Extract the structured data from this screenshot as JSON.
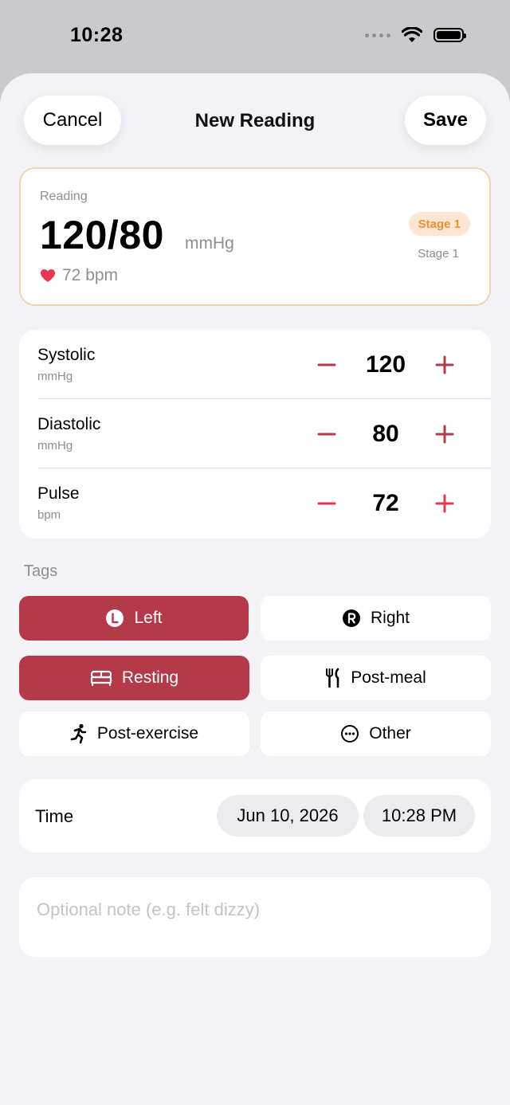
{
  "status_bar": {
    "time": "10:28"
  },
  "nav": {
    "cancel_label": "Cancel",
    "title": "New Reading",
    "save_label": "Save"
  },
  "summary": {
    "label": "Reading",
    "value": "120/80",
    "unit": "mmHg",
    "pulse": "72 bpm",
    "stage_badge": "Stage 1",
    "stage_text": "Stage 1"
  },
  "steppers": [
    {
      "name": "Systolic",
      "unit": "mmHg",
      "value": "120"
    },
    {
      "name": "Diastolic",
      "unit": "mmHg",
      "value": "80"
    },
    {
      "name": "Pulse",
      "unit": "bpm",
      "value": "72"
    }
  ],
  "tags": {
    "section_label": "Tags",
    "items": [
      {
        "label": "Left",
        "icon": "left-arm-icon",
        "selected": true
      },
      {
        "label": "Right",
        "icon": "right-arm-icon",
        "selected": false
      },
      {
        "label": "Resting",
        "icon": "bed-icon",
        "selected": true
      },
      {
        "label": "Post-meal",
        "icon": "fork-knife-icon",
        "selected": false
      },
      {
        "label": "Post-exercise",
        "icon": "running-icon",
        "selected": false
      },
      {
        "label": "Other",
        "icon": "ellipsis-circle-icon",
        "selected": false
      }
    ]
  },
  "time": {
    "label": "Time",
    "date": "Jun 10, 2026",
    "clock": "10:28 PM"
  },
  "note": {
    "placeholder": "Optional note (e.g. felt dizzy)",
    "value": ""
  },
  "colors": {
    "accent": "#b53a49",
    "stage_bg": "#fde7d4",
    "stage_fg": "#ef8f34",
    "card_border": "#f6d3ad",
    "heart": "#e8364f",
    "stepper_minus": "#b53a49",
    "stepper_plus": "#b53a49",
    "pulse_stepper": "#e8364f"
  }
}
